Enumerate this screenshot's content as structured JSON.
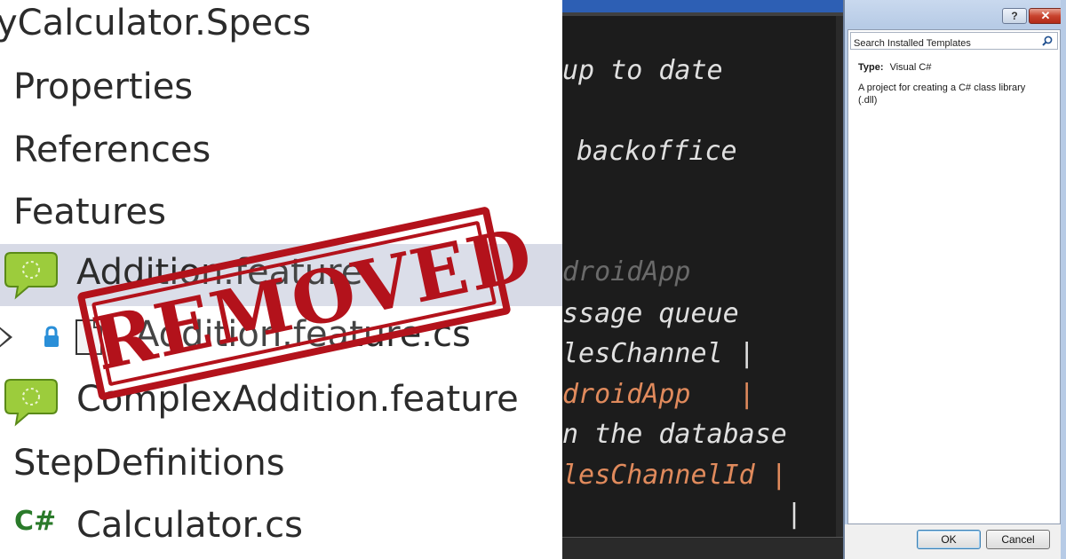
{
  "solution_explorer": {
    "project_title": "yCalculator.Specs",
    "items": [
      {
        "label": "Properties"
      },
      {
        "label": "References"
      },
      {
        "label": "Features"
      },
      {
        "label": "Addition.feature"
      },
      {
        "label": "Addition.feature.cs"
      },
      {
        "label": "ComplexAddition.feature"
      },
      {
        "label": "StepDefinitions"
      },
      {
        "label": "Calculator.cs"
      }
    ],
    "csharp_badge": "C#",
    "stamp_text": "REMOVED"
  },
  "console": {
    "lines": [
      {
        "text": "up to date",
        "color": "#e0e0e0"
      },
      {
        "text": "backoffice",
        "color": "#e0e0e0"
      },
      {
        "text": "droidApp",
        "color": "#6a6a6a"
      },
      {
        "text": "ssage queue",
        "color": "#e0e0e0"
      },
      {
        "text": "lesChannel |",
        "color": "#e0e0e0"
      },
      {
        "text": "droidApp   |",
        "color": "#e08a5c"
      },
      {
        "text": "n the database",
        "color": "#e0e0e0"
      },
      {
        "text": "lesChannelId |",
        "color": "#e08a5c"
      },
      {
        "text": "|",
        "color": "#e0e0e0"
      }
    ]
  },
  "template_dialog": {
    "help_label": "?",
    "close_label": "✕",
    "search_placeholder": "Search Installed Templates",
    "type_label": "Type:",
    "type_value": "Visual C#",
    "description": "A project for creating a C# class library (.dll)",
    "ok_label": "OK",
    "cancel_label": "Cancel"
  },
  "colors": {
    "selection": "#d7dae6",
    "stamp_red": "#b3121b",
    "console_bg": "#1c1c1c"
  }
}
